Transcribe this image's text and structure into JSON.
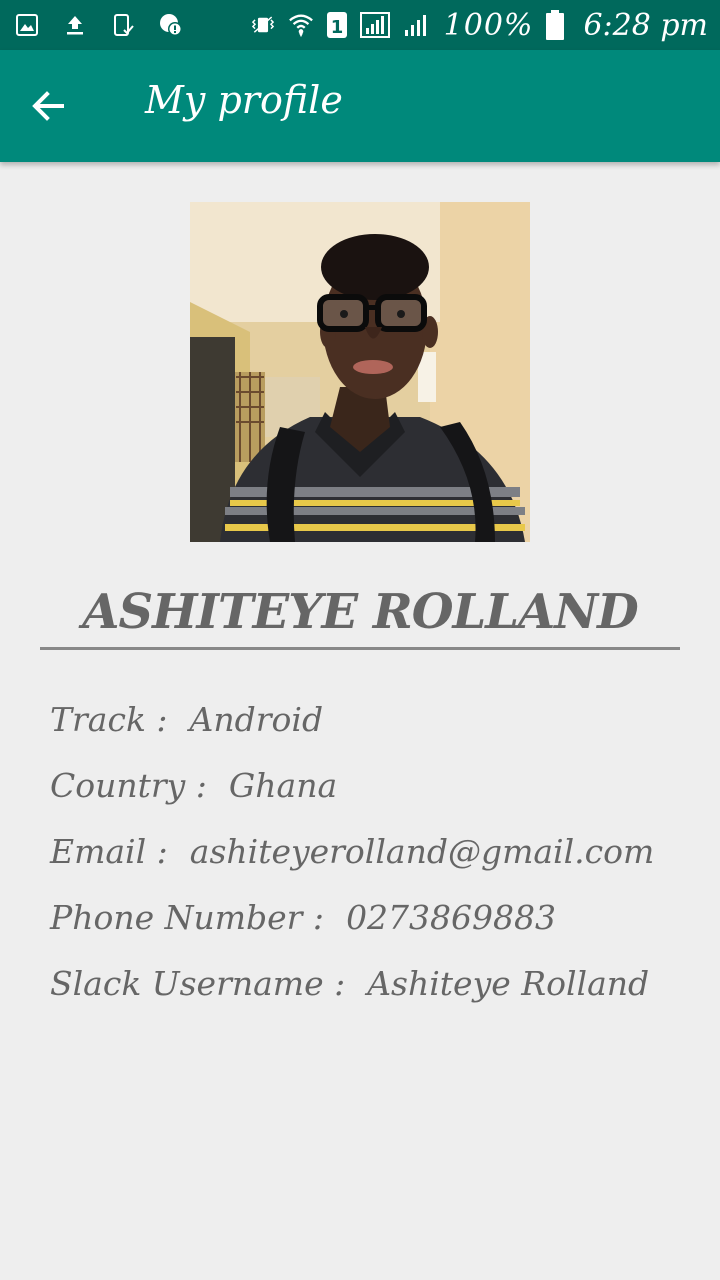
{
  "status_bar": {
    "battery": "100%",
    "time": "6:28 pm",
    "sim_slot": "1",
    "left_icons": [
      "image-icon",
      "upload-icon",
      "phone-check-icon",
      "location-alert-icon"
    ],
    "right_icons": [
      "vibrate-icon",
      "wifi-icon",
      "sim-icon",
      "signal-icon",
      "signal-icon",
      "battery-icon"
    ]
  },
  "app_bar": {
    "back_icon": "arrow-back-icon",
    "title": "My profile",
    "color": "#00897b"
  },
  "profile": {
    "name": "ASHITEYE ROLLAND",
    "fields": [
      {
        "label": "Track :",
        "value": "Android"
      },
      {
        "label": "Country :",
        "value": "Ghana"
      },
      {
        "label": "Email :",
        "value": "ashiteyerolland@gmail.com"
      },
      {
        "label": "Phone Number :",
        "value": "0273869883"
      },
      {
        "label": "Slack Username :",
        "value": "Ashiteye Rolland"
      }
    ]
  },
  "colors": {
    "status_bar": "#00695c",
    "app_bar": "#00897b",
    "background": "#eeeeee",
    "text": "#666666"
  }
}
